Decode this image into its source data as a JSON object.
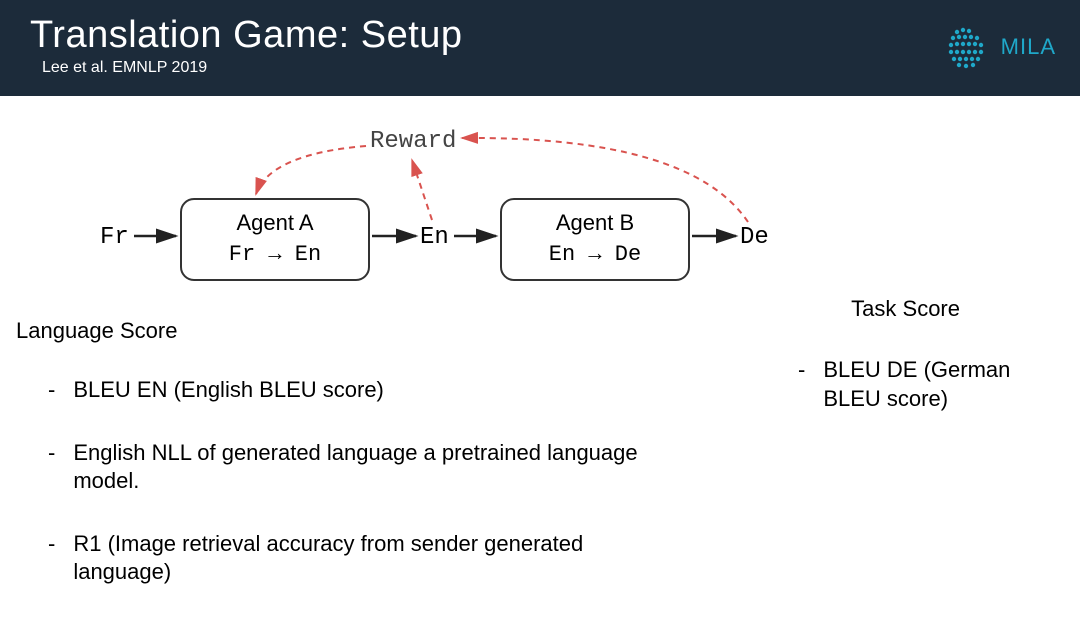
{
  "header": {
    "title": "Translation Game: Setup",
    "subtitle": "Lee et al. EMNLP 2019",
    "logo_text": "MILA"
  },
  "diagram": {
    "reward": "Reward",
    "node_fr": "Fr",
    "node_en": "En",
    "node_de": "De",
    "agent_a": {
      "title": "Agent A",
      "sub": "Fr → En"
    },
    "agent_b": {
      "title": "Agent B",
      "sub": "En → De"
    }
  },
  "language_score": {
    "title": "Language Score",
    "bullets": [
      "BLEU EN (English BLEU score)",
      "English NLL of generated language a pretrained language model.",
      "R1 (Image retrieval accuracy from sender generated language)"
    ]
  },
  "task_score": {
    "title": "Task Score",
    "bullets": [
      "BLEU DE (German BLEU score)"
    ]
  }
}
